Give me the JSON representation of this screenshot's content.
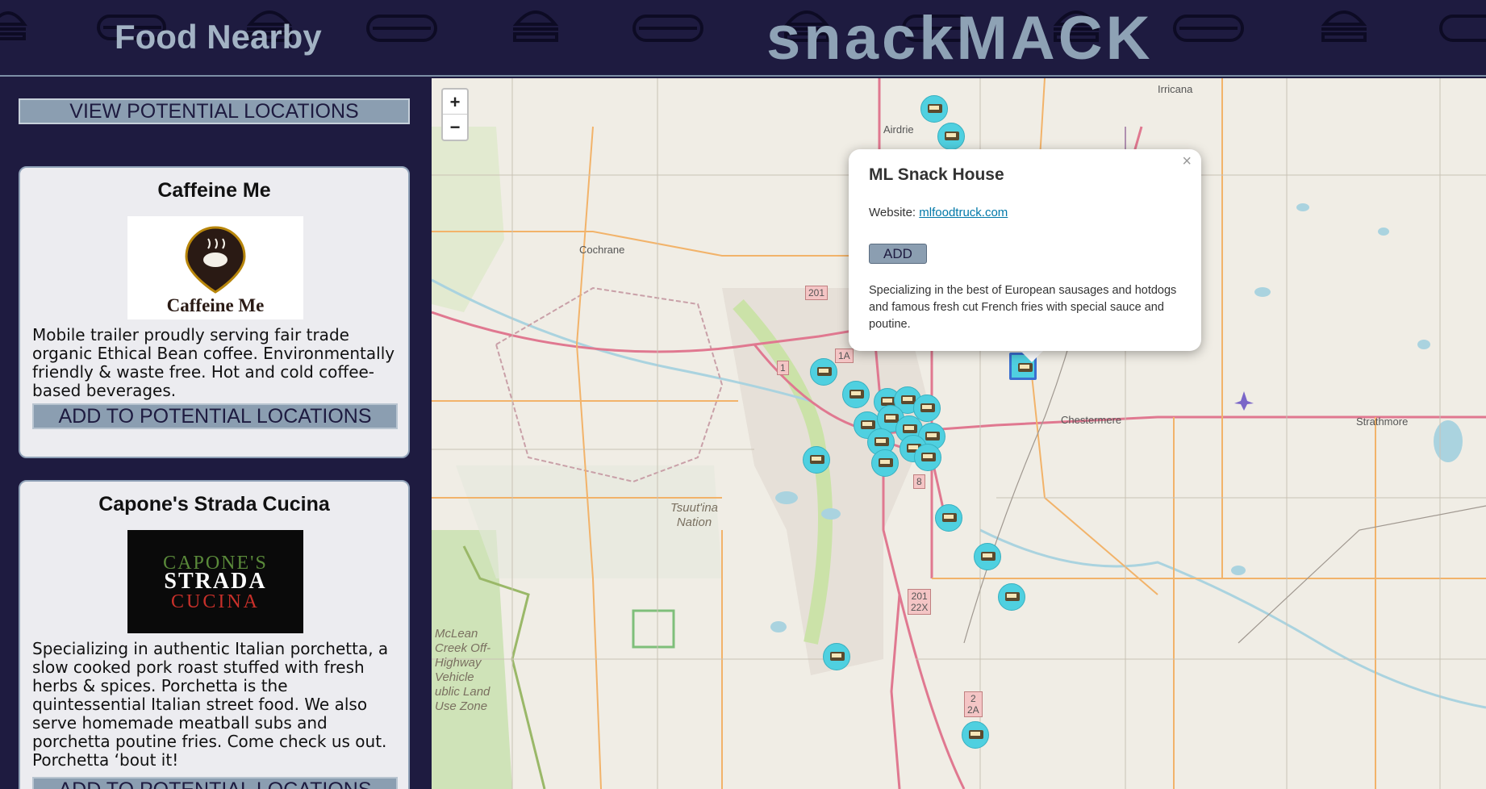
{
  "header": {
    "section_title": "Food Nearby",
    "brand": "snackMACK"
  },
  "sidebar": {
    "view_button": "VIEW POTENTIAL LOCATIONS",
    "cards": [
      {
        "title": "Caffeine Me",
        "logo_text": "Caffeine Me",
        "description": "Mobile trailer proudly serving fair trade organic Ethical Bean coffee. Environmentally friendly & waste free. Hot and cold coffee-based beverages.",
        "add_label": "ADD TO POTENTIAL LOCATIONS"
      },
      {
        "title": "Capone's Strada Cucina",
        "logo_lines": [
          "CAPONE'S",
          "STRADA",
          "CUCINA"
        ],
        "description": "Specializing in authentic Italian porchetta, a slow cooked pork roast stuffed with fresh herbs & spices. Porchetta is the quintessential Italian street food. We also serve homemade meatball subs and porchetta poutine fries. Come check us out. Porchetta ‘bout it!",
        "add_label": "ADD TO POTENTIAL LOCATIONS"
      }
    ]
  },
  "map": {
    "zoom_in": "+",
    "zoom_out": "−",
    "labels": {
      "irricana": "Irricana",
      "airdrie": "Airdrie",
      "cochrane": "Cochrane",
      "chestermere": "Chestermere",
      "strathmore": "Strathmore",
      "tsuutina_1": "Tsuut'ina",
      "tsuutina_2": "Nation",
      "mclean_1": "McLean",
      "mclean_2": "Creek Off-",
      "mclean_3": "Highway",
      "mclean_4": "Vehicle",
      "mclean_5": "ublic Land",
      "mclean_6": "Use Zone"
    },
    "shields": {
      "r201": "201",
      "r1a": "1A",
      "r1": "1",
      "r8": "8",
      "r201b": "201",
      "r22x": "22X",
      "r2": "2",
      "r2a": "2A"
    },
    "popup": {
      "close": "×",
      "title": "ML Snack House",
      "website_label": "Website:",
      "website_link": "mlfoodtruck.com",
      "add_label": "ADD",
      "description": "Specializing in the best of European sausages and hotdogs and famous fresh cut French fries with special sauce and poutine."
    }
  },
  "colors": {
    "navy": "#1e1b40",
    "slate": "#8b9eb1",
    "card_bg": "#ececf0",
    "marker": "#4fd0e0"
  },
  "icons": [
    "burger-icon",
    "hotdog-icon",
    "food-truck-icon",
    "airport-icon"
  ]
}
